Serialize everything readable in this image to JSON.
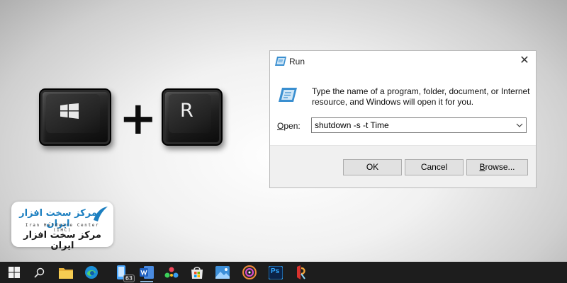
{
  "keys": {
    "first_key_icon": "windows-logo-icon",
    "second_key_letter": "R",
    "combine_symbol": "+"
  },
  "run_dialog": {
    "title": "Run",
    "close_glyph": "✕",
    "description": "Type the name of a program, folder, document, or Internet resource, and Windows will open it for you.",
    "open_label_prefix": "O",
    "open_label_rest": "pen:",
    "open_value": "shutdown -s -t Time",
    "buttons": {
      "ok": "OK",
      "cancel": "Cancel",
      "browse_prefix": "B",
      "browse_rest": "rowse..."
    }
  },
  "logo": {
    "persian_top": "مرکز سخت افزار ایران",
    "english": "Iran Hardware Center (IHC)",
    "persian_bottom": "مرکز سخت افزار ایران"
  },
  "taskbar": {
    "items": [
      {
        "icon": "windows-start-icon"
      },
      {
        "icon": "search-icon"
      },
      {
        "icon": "file-explorer-icon"
      },
      {
        "icon": "edge-browser-icon"
      },
      {
        "icon": "phone-link-icon",
        "badge": "63"
      },
      {
        "icon": "word-icon"
      },
      {
        "icon": "apps-dots-icon"
      },
      {
        "icon": "store-icon"
      },
      {
        "icon": "photos-icon"
      },
      {
        "icon": "media-player-icon"
      },
      {
        "icon": "photoshop-icon",
        "label": "Ps"
      },
      {
        "icon": "recovery-tool-icon"
      }
    ]
  },
  "colors": {
    "taskbar_bg": "#1d1d1d",
    "dialog_footer": "#f0f0f0",
    "logo_blue": "#1c7fc0"
  }
}
